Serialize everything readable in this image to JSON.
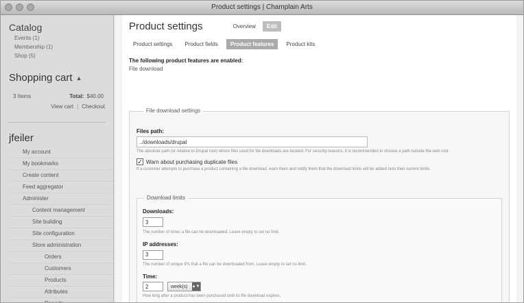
{
  "window": {
    "title": "Product settings | Champlain Arts"
  },
  "sidebar": {
    "catalog_title": "Catalog",
    "catalog_items": [
      {
        "label": "Events (1)"
      },
      {
        "label": "Membership (1)"
      },
      {
        "label": "Shop (5)"
      }
    ],
    "cart_title": "Shopping cart",
    "cart_items": "3 Items",
    "cart_total_label": "Total:",
    "cart_total_value": "$40.00",
    "view_cart": "View cart",
    "cart_sep": "|",
    "checkout": "Checkout",
    "user_title": "jfeiler",
    "nav": [
      {
        "label": "My account",
        "level": 1
      },
      {
        "label": "My bookmarks",
        "level": 1
      },
      {
        "label": "Create content",
        "level": 1
      },
      {
        "label": "Feed aggregator",
        "level": 1
      },
      {
        "label": "Administer",
        "level": 1
      },
      {
        "label": "Content management",
        "level": 2
      },
      {
        "label": "Site building",
        "level": 2
      },
      {
        "label": "Site configuration",
        "level": 2
      },
      {
        "label": "Store administration",
        "level": 2
      },
      {
        "label": "Orders",
        "level": 3
      },
      {
        "label": "Customers",
        "level": 3
      },
      {
        "label": "Products",
        "level": 3
      },
      {
        "label": "Attributes",
        "level": 3
      },
      {
        "label": "Reports",
        "level": 3
      }
    ]
  },
  "main": {
    "page_title": "Product settings",
    "primary_tabs": [
      {
        "label": "Overview",
        "active": false
      },
      {
        "label": "Edit",
        "active": true
      }
    ],
    "sub_tabs": [
      {
        "label": "Product settings",
        "active": false
      },
      {
        "label": "Product fields",
        "active": false
      },
      {
        "label": "Product features",
        "active": true
      },
      {
        "label": "Product kits",
        "active": false
      }
    ],
    "enabled_heading": "The following product features are enabled:",
    "enabled_item": "File download",
    "file_download": {
      "legend": "File download settings",
      "files_path_label": "Files path:",
      "files_path_value": "../downloads/drupal",
      "files_path_desc": "The absolute path (or relative to Drupal root) where files used for file downloads are located. For security reasons, it is recommended to choose a path outside the web root.",
      "warn_dup_label": "Warn about purchasing duplicate files",
      "warn_dup_checked": true,
      "warn_dup_desc": "If a customer attempts to purchase a product containing a file download, warn them and notify them that the download limits will be added onto their current limits.",
      "limits_legend": "Download limits",
      "downloads_label": "Downloads:",
      "downloads_value": "3",
      "downloads_desc": "The number of times a file can be downloaded. Leave empty to set no limit.",
      "ip_label": "IP addresses:",
      "ip_value": "3",
      "ip_desc": "The number of unique IPs that a file can be downloaded from. Leave empty to set no limit.",
      "time_label": "Time:",
      "time_value": "2",
      "time_unit": "week(s)",
      "time_desc": "How long after a product has been purchased until its file download expires."
    }
  }
}
